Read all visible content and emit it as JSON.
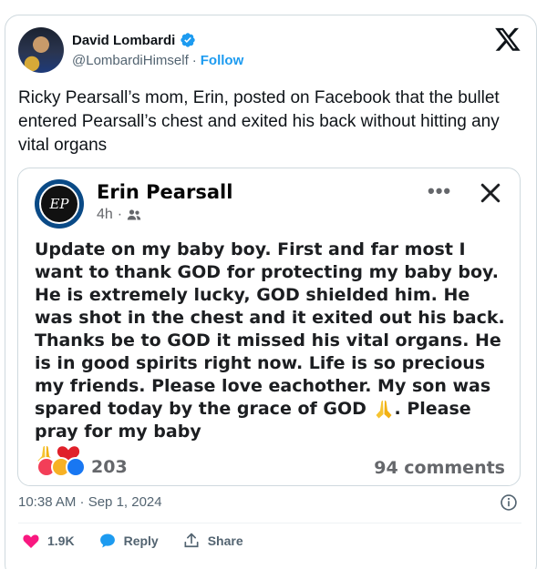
{
  "author": {
    "name": "David Lombardi",
    "handle": "@LombardiHimself",
    "separator": "·",
    "follow_label": "Follow"
  },
  "tweet": {
    "text": "Ricky Pearsall’s mom, Erin, posted on Facebook that the bullet entered Pearsall’s chest and exited his back without hitting any vital organs",
    "timestamp": "10:38 AM · Sep 1, 2024"
  },
  "fb_post": {
    "avatar_monogram": "EP",
    "name": "Erin Pearsall",
    "time": "4h",
    "meta_separator": "·",
    "body_main": "Update on my baby boy. First and far most I want to thank GOD for protecting my baby boy. He is extremely lucky, GOD shielded him. He was shot in the chest and it exited out his back. Thanks be to GOD it missed his vital organs. He is in good spirits right now. Life is so precious my friends. Please love eachother. My son was spared today by the grace of GOD ",
    "body_tail": ". Please pray for my baby",
    "reaction_count": "203",
    "comments": "94 comments"
  },
  "actions": {
    "like_count": "1.9K",
    "reply_label": "Reply",
    "share_label": "Share"
  },
  "colors": {
    "accent": "#1d9bf0",
    "like": "#f91880",
    "text": "#0f1419",
    "muted": "#536471"
  },
  "icons": [
    "verified-badge-icon",
    "x-logo-icon",
    "more-options-icon",
    "close-icon",
    "friends-icon",
    "praying-hands-icon",
    "heart-icon",
    "info-icon",
    "reply-icon",
    "share-icon"
  ]
}
